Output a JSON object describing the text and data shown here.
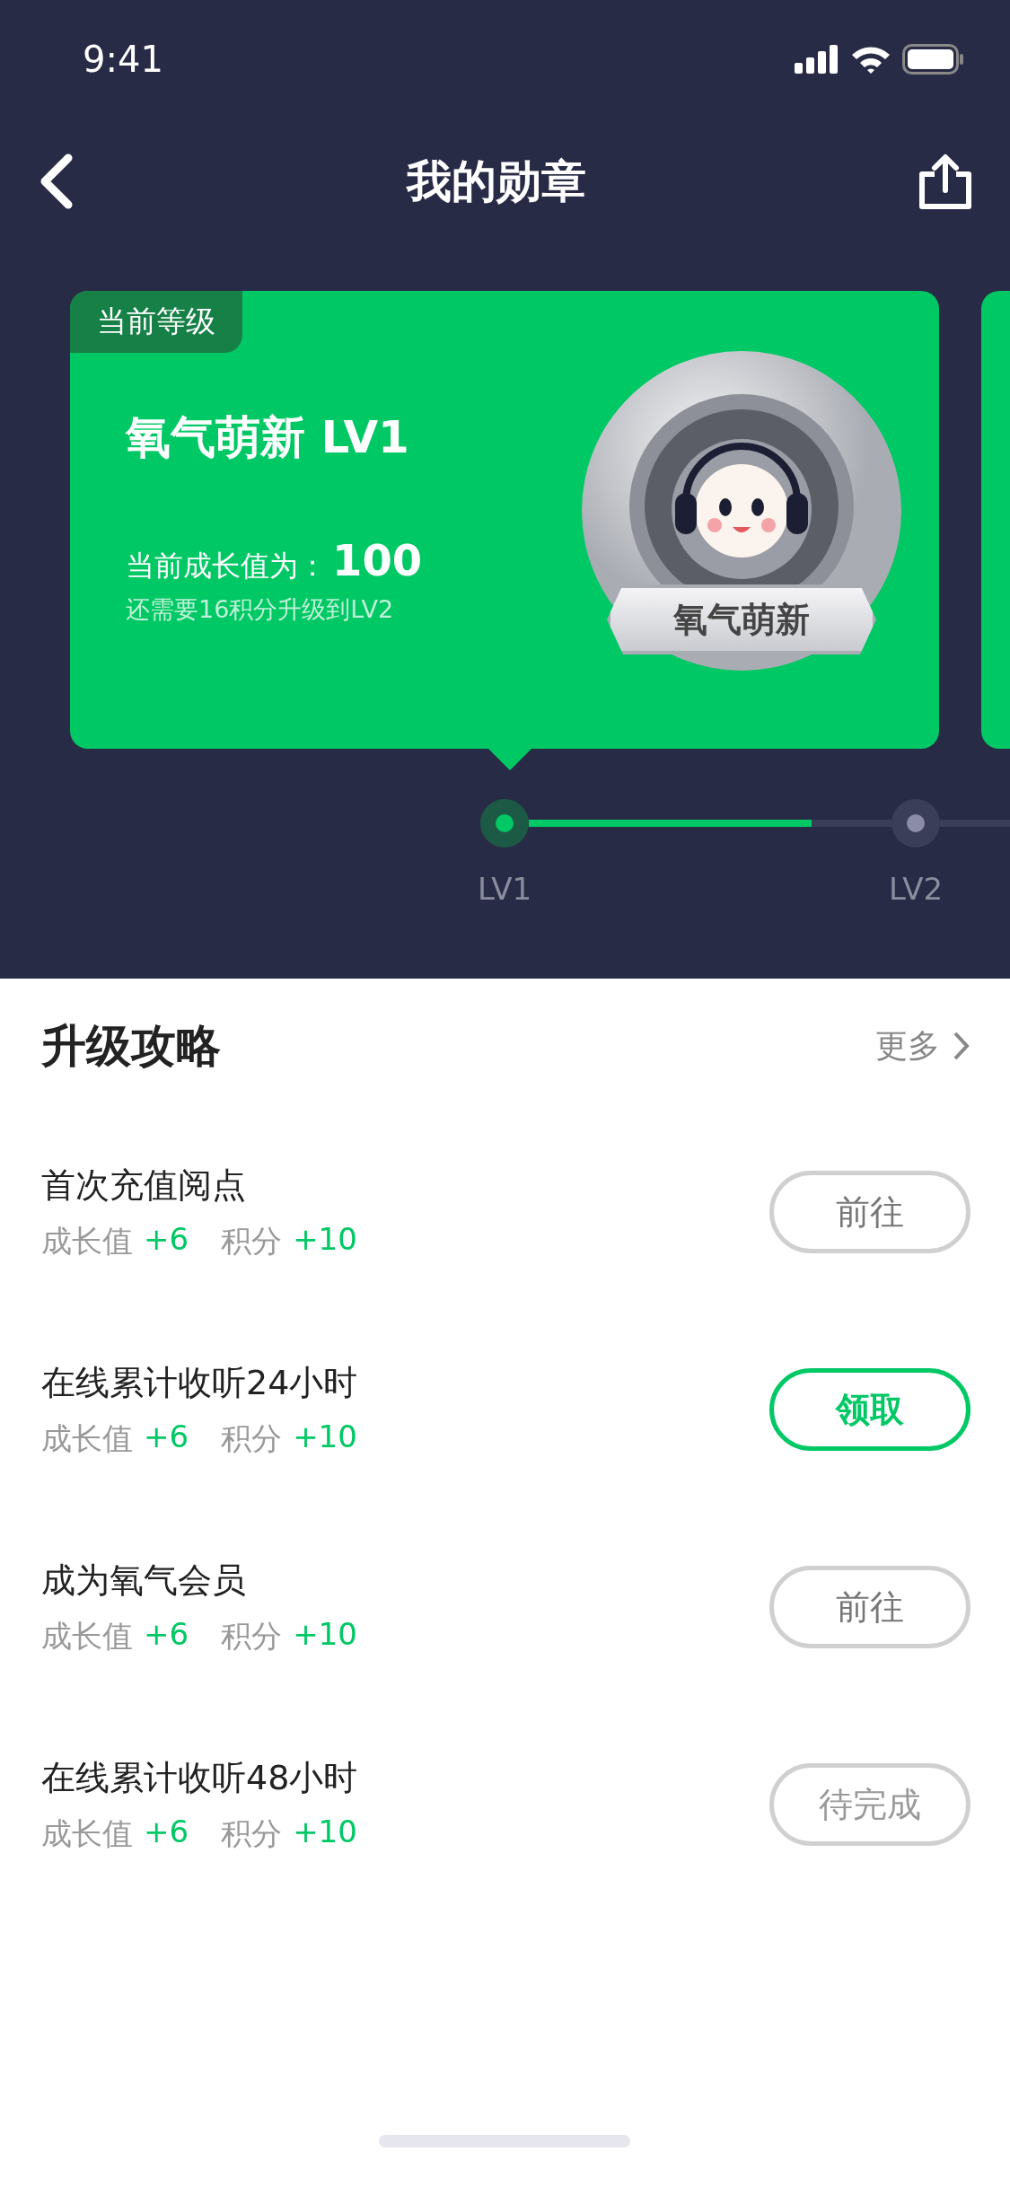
{
  "status_bar": {
    "time": "9:41"
  },
  "nav": {
    "title": "我的勋章"
  },
  "level_card": {
    "tag": "当前等级",
    "title": "氧气萌新 LV1",
    "growth_label": "当前成长值为：",
    "growth_value": "100",
    "hint": "还需要16积分升级到LV2",
    "badge_label": "氧气萌新"
  },
  "level_track": {
    "level": 0.78,
    "nodes": [
      {
        "label": "LV1",
        "selected": true
      },
      {
        "label": "LV2",
        "selected": false
      }
    ]
  },
  "strategy": {
    "title": "升级攻略",
    "more": "更多",
    "tasks": [
      {
        "title": "首次充值阅点",
        "growth_label": "成长值",
        "growth_value": "+6",
        "points_label": "积分",
        "points_value": "+10",
        "action": "前往",
        "kind": "go"
      },
      {
        "title": "在线累计收听24小时",
        "growth_label": "成长值",
        "growth_value": "+6",
        "points_label": "积分",
        "points_value": "+10",
        "action": "领取",
        "kind": "claim"
      },
      {
        "title": "成为氧气会员",
        "growth_label": "成长值",
        "growth_value": "+6",
        "points_label": "积分",
        "points_value": "+10",
        "action": "前往",
        "kind": "go"
      },
      {
        "title": "在线累计收听48小时",
        "growth_label": "成长值",
        "growth_value": "+6",
        "points_label": "积分",
        "points_value": "+10",
        "action": "待完成",
        "kind": "pending"
      }
    ]
  }
}
